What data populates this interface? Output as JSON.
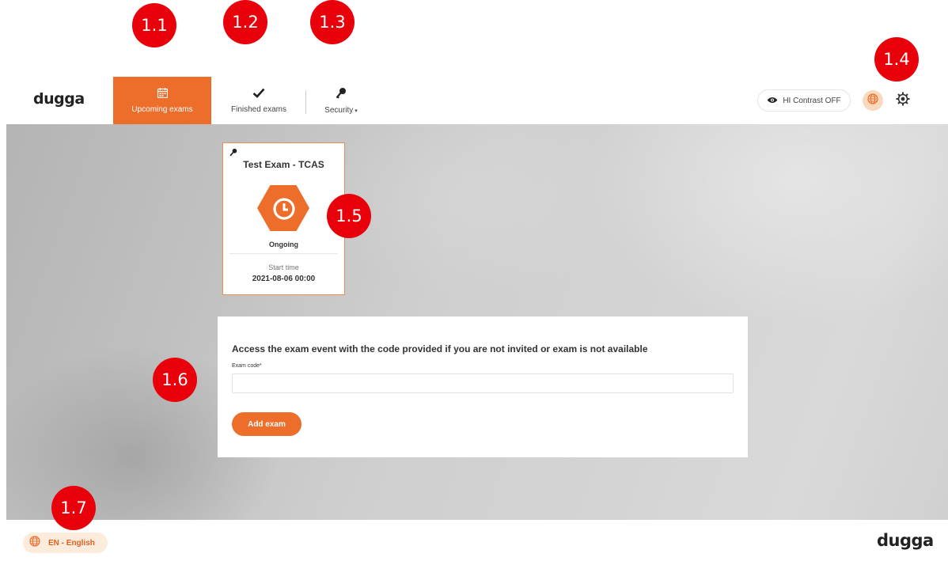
{
  "brand": {
    "logo_text": "dugga"
  },
  "nav": {
    "upcoming_label": "Upcoming exams",
    "finished_label": "Finished exams",
    "security_label": "Security",
    "security_caret": "▾"
  },
  "toolbar": {
    "contrast_label": "HI Contrast OFF"
  },
  "exam_card": {
    "title": "Test Exam - TCAS",
    "status": "Ongoing",
    "start_label": "Start time",
    "start_value": "2021-08-06 00:00"
  },
  "access": {
    "heading": "Access the exam event with the code provided if you are not invited or exam is not available",
    "field_label": "Exam code*",
    "field_value": "",
    "field_placeholder": "",
    "button_label": "Add exam"
  },
  "footer": {
    "language_label": "EN - English"
  },
  "annotations": [
    "1.1",
    "1.2",
    "1.3",
    "1.4",
    "1.5",
    "1.6",
    "1.7"
  ],
  "colors": {
    "accent": "#ed6d2b",
    "marker": "#e8000a",
    "language_tint": "#fdebdc"
  }
}
